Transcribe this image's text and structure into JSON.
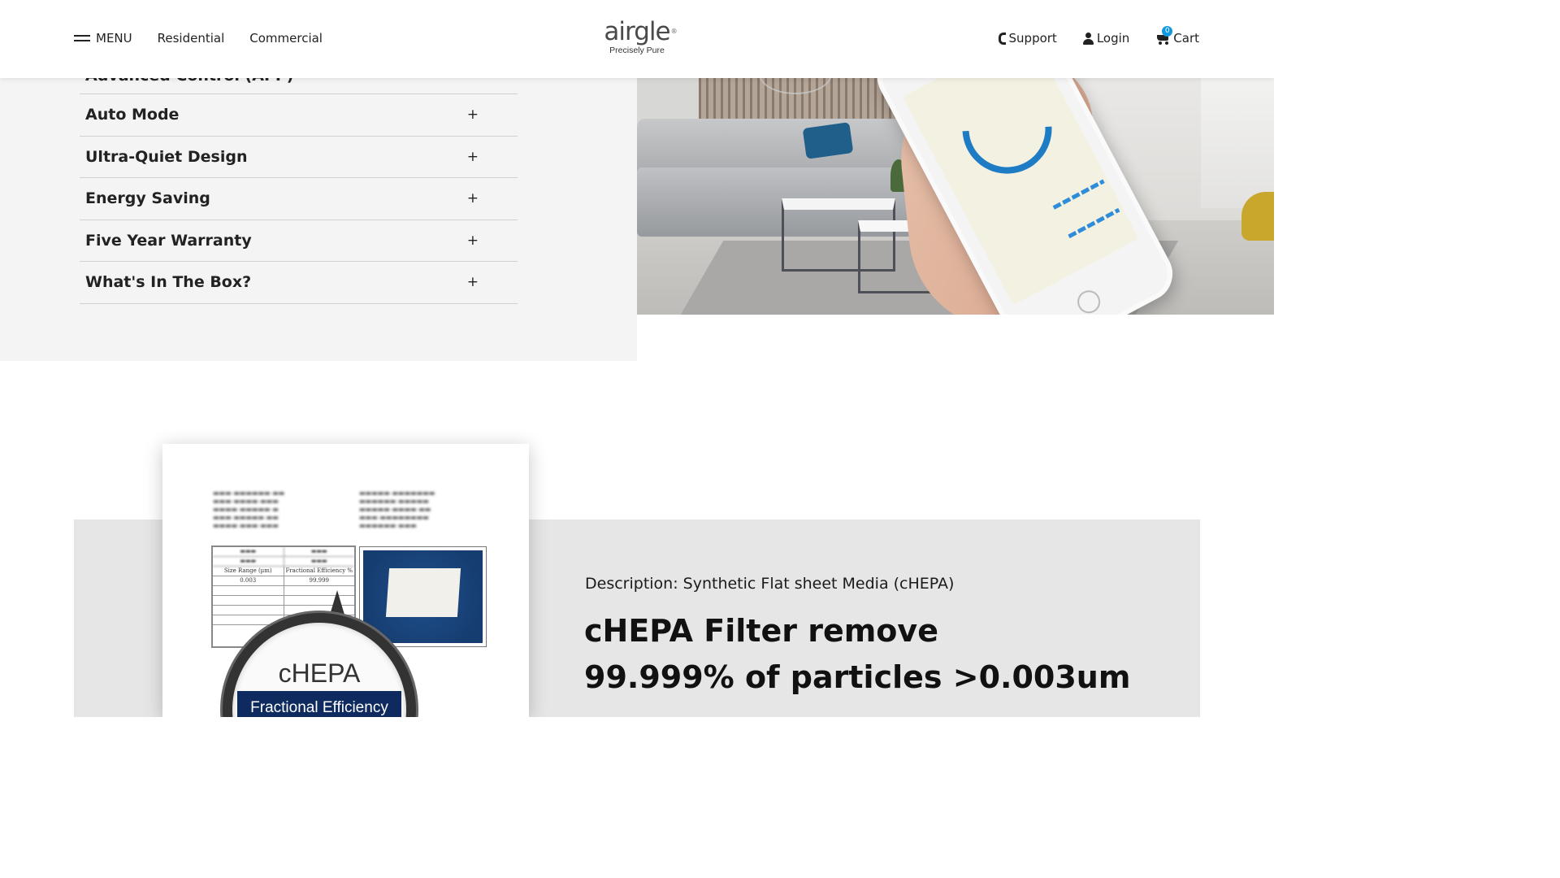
{
  "header": {
    "menu_label": "MENU",
    "nav_links": [
      "Residential",
      "Commercial"
    ],
    "logo_text": "airgle",
    "logo_reg": "®",
    "logo_tagline": "Precisely Pure",
    "support_label": "Support",
    "login_label": "Login",
    "cart_label": "Cart",
    "cart_count": "0",
    "icons": {
      "menu": "hamburger-icon",
      "support": "phone-icon",
      "login": "user-icon",
      "cart": "cart-icon"
    }
  },
  "accordion": {
    "clipped_item": "Advanced Control (APP)",
    "items": [
      {
        "title": "Auto Mode",
        "toggle": "+"
      },
      {
        "title": "Ultra-Quiet Design",
        "toggle": "+"
      },
      {
        "title": "Energy Saving",
        "toggle": "+"
      },
      {
        "title": "Five Year Warranty",
        "toggle": "+"
      },
      {
        "title": "What's In The Box?",
        "toggle": "+"
      }
    ]
  },
  "report": {
    "table_headers": [
      "Size Range (µm)",
      "Fractional Efficiency %"
    ],
    "table_values": [
      "0.003",
      "99.999"
    ],
    "magnifier_title": "cHEPA",
    "magnifier_label": "Fractional Efficiency"
  },
  "product": {
    "description": "Description: Synthetic Flat sheet Media (cHEPA)",
    "headline_line1": "cHEPA Filter remove",
    "headline_line2": "99.999% of particles >0.003um"
  },
  "colors": {
    "accent_blue": "#1199dd",
    "navy_label": "#0f2a5e",
    "panel_gray": "#f4f4f4",
    "band_gray": "#e6e6e6"
  }
}
